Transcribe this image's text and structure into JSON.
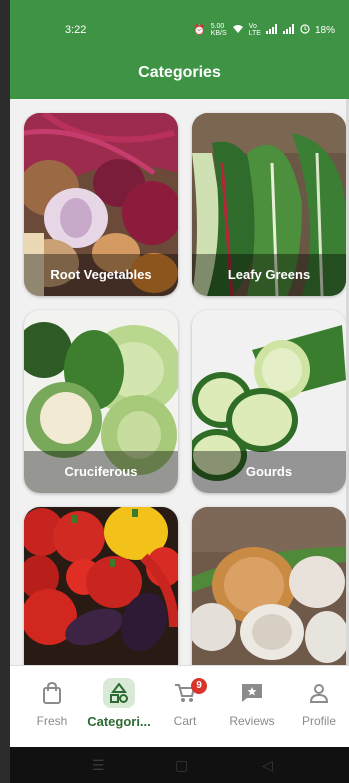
{
  "status_bar": {
    "time": "3:22",
    "data_speed_top": "5.00",
    "data_speed_bottom": "KB/S",
    "network_top": "Vo",
    "network_bottom": "LTE",
    "battery": "18%"
  },
  "header": {
    "title": "Categories"
  },
  "categories": [
    {
      "label": "Root Vegetables"
    },
    {
      "label": "Leafy Greens"
    },
    {
      "label": "Cruciferous"
    },
    {
      "label": "Gourds"
    },
    {
      "label": ""
    },
    {
      "label": ""
    }
  ],
  "bottom_nav": {
    "items": [
      {
        "label": "Fresh",
        "icon": "shopping-bag-icon"
      },
      {
        "label": "Categori...",
        "icon": "categories-shapes-icon",
        "active": true
      },
      {
        "label": "Cart",
        "icon": "cart-icon",
        "badge": "9"
      },
      {
        "label": "Reviews",
        "icon": "reviews-star-icon"
      },
      {
        "label": "Profile",
        "icon": "profile-person-icon"
      }
    ]
  },
  "colors": {
    "primary": "#3e9444",
    "active_text": "#2d6a32",
    "badge": "#d9342b"
  }
}
